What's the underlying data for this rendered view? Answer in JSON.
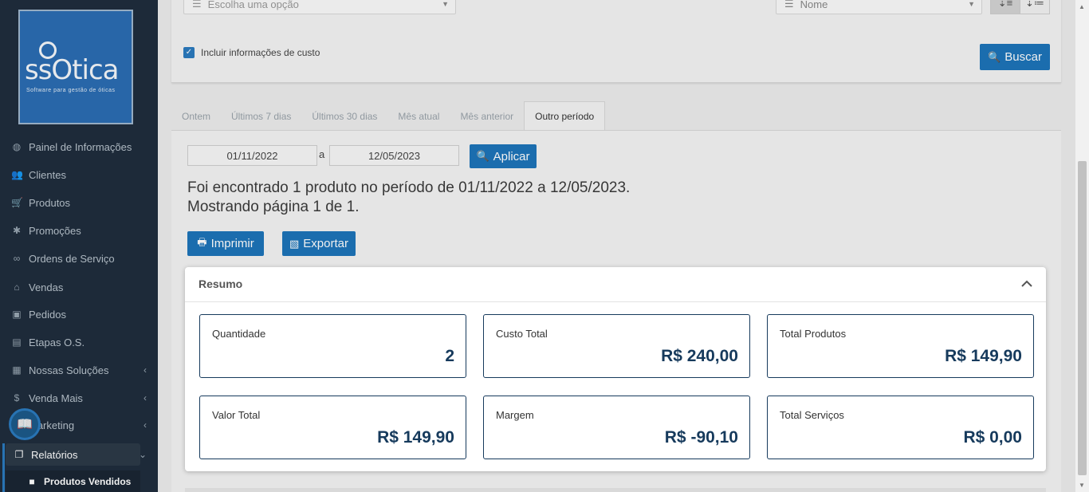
{
  "logo": {
    "brand": "ssOtica",
    "tagline": "Software para gestão de óticas"
  },
  "sidebar": {
    "items": [
      {
        "label": "Painel de Informações",
        "icon": "dashboard-icon"
      },
      {
        "label": "Clientes",
        "icon": "users-icon"
      },
      {
        "label": "Produtos",
        "icon": "cart-icon"
      },
      {
        "label": "Promoções",
        "icon": "asterisk-icon"
      },
      {
        "label": "Ordens de Serviço",
        "icon": "glasses-icon"
      },
      {
        "label": "Vendas",
        "icon": "basket-icon"
      },
      {
        "label": "Pedidos",
        "icon": "inbox-icon"
      },
      {
        "label": "Etapas O.S.",
        "icon": "keyboard-icon"
      },
      {
        "label": "Nossas Soluções",
        "icon": "briefcase-icon"
      },
      {
        "label": "Venda Mais",
        "icon": "dollar-icon"
      },
      {
        "label": "Marketing",
        "icon": "megaphone-icon"
      },
      {
        "label": "Relatórios",
        "icon": "copy-icon"
      },
      {
        "label": "Produtos Vendidos",
        "icon": "bag-icon"
      }
    ]
  },
  "filters": {
    "option_select": "Escolha uma opção",
    "sort_select": "Nome",
    "include_cost_label": "Incluir informações de custo",
    "search_button": "Buscar"
  },
  "tabs": [
    "Ontem",
    "Últimos 7 dias",
    "Últimos 30 dias",
    "Mês atual",
    "Mês anterior",
    "Outro período"
  ],
  "period": {
    "from": "01/11/2022",
    "separator": "a",
    "to": "12/05/2023",
    "apply_button": "Aplicar"
  },
  "results": {
    "line1": "Foi encontrado 1 produto no período de 01/11/2022 a 12/05/2023.",
    "line2": "Mostrando página 1 de 1."
  },
  "actions": {
    "print": "Imprimir",
    "export": "Exportar"
  },
  "resumo": {
    "title": "Resumo",
    "stats": [
      {
        "label": "Quantidade",
        "value": "2"
      },
      {
        "label": "Custo Total",
        "value": "R$ 240,00"
      },
      {
        "label": "Total Produtos",
        "value": "R$ 149,90"
      },
      {
        "label": "Valor Total",
        "value": "R$ 149,90"
      },
      {
        "label": "Margem",
        "value": "R$ -90,10"
      },
      {
        "label": "Total Serviços",
        "value": "R$ 0,00"
      }
    ]
  },
  "colors": {
    "sidebar": "#1f2d3d",
    "accent": "#1d74b9",
    "stat_text": "#163a5c"
  }
}
